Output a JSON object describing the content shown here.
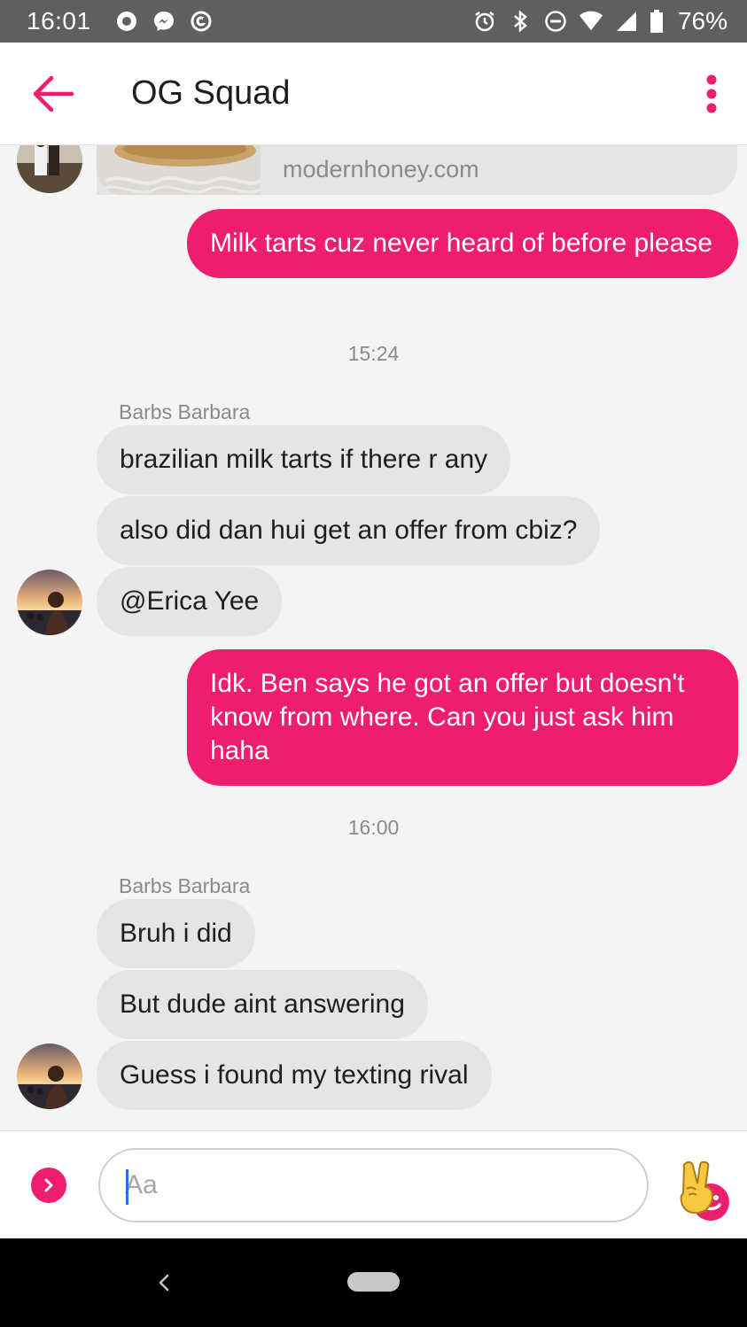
{
  "status_bar": {
    "time": "16:01",
    "battery": "76%",
    "icons_left": [
      "outlook-icon",
      "messenger-icon",
      "at-icon"
    ],
    "icons_right": [
      "alarm-icon",
      "bluetooth-icon",
      "dnd-icon",
      "wifi-icon",
      "signal-icon",
      "battery-icon"
    ]
  },
  "header": {
    "title": "OG Squad",
    "accent_color": "#ee1d6d"
  },
  "link_preview": {
    "domain": "modernhoney.com"
  },
  "messages": [
    {
      "type": "outgoing",
      "text": "Milk tarts cuz never heard of before please"
    },
    {
      "type": "timestamp",
      "text": "15:24"
    },
    {
      "type": "sender",
      "text": "Barbs Barbara"
    },
    {
      "type": "incoming",
      "text": "brazilian milk tarts if there r any"
    },
    {
      "type": "incoming",
      "text": "also did dan hui get an offer from cbiz?"
    },
    {
      "type": "incoming",
      "text": "@Erica Yee"
    },
    {
      "type": "outgoing",
      "text": "Idk. Ben says he got an offer but doesn't know from where. Can you just ask him haha"
    },
    {
      "type": "timestamp",
      "text": "16:00"
    },
    {
      "type": "sender",
      "text": "Barbs Barbara"
    },
    {
      "type": "incoming",
      "text": "Bruh i did"
    },
    {
      "type": "incoming",
      "text": "But dude aint answering"
    },
    {
      "type": "incoming",
      "text": "Guess i found my texting rival"
    }
  ],
  "composer": {
    "placeholder": "Aa",
    "quick_reaction": "✌"
  },
  "colors": {
    "accent": "#ee1d6d",
    "incoming_bubble": "#e5e5e5",
    "status_bar": "#5f5f5f"
  }
}
